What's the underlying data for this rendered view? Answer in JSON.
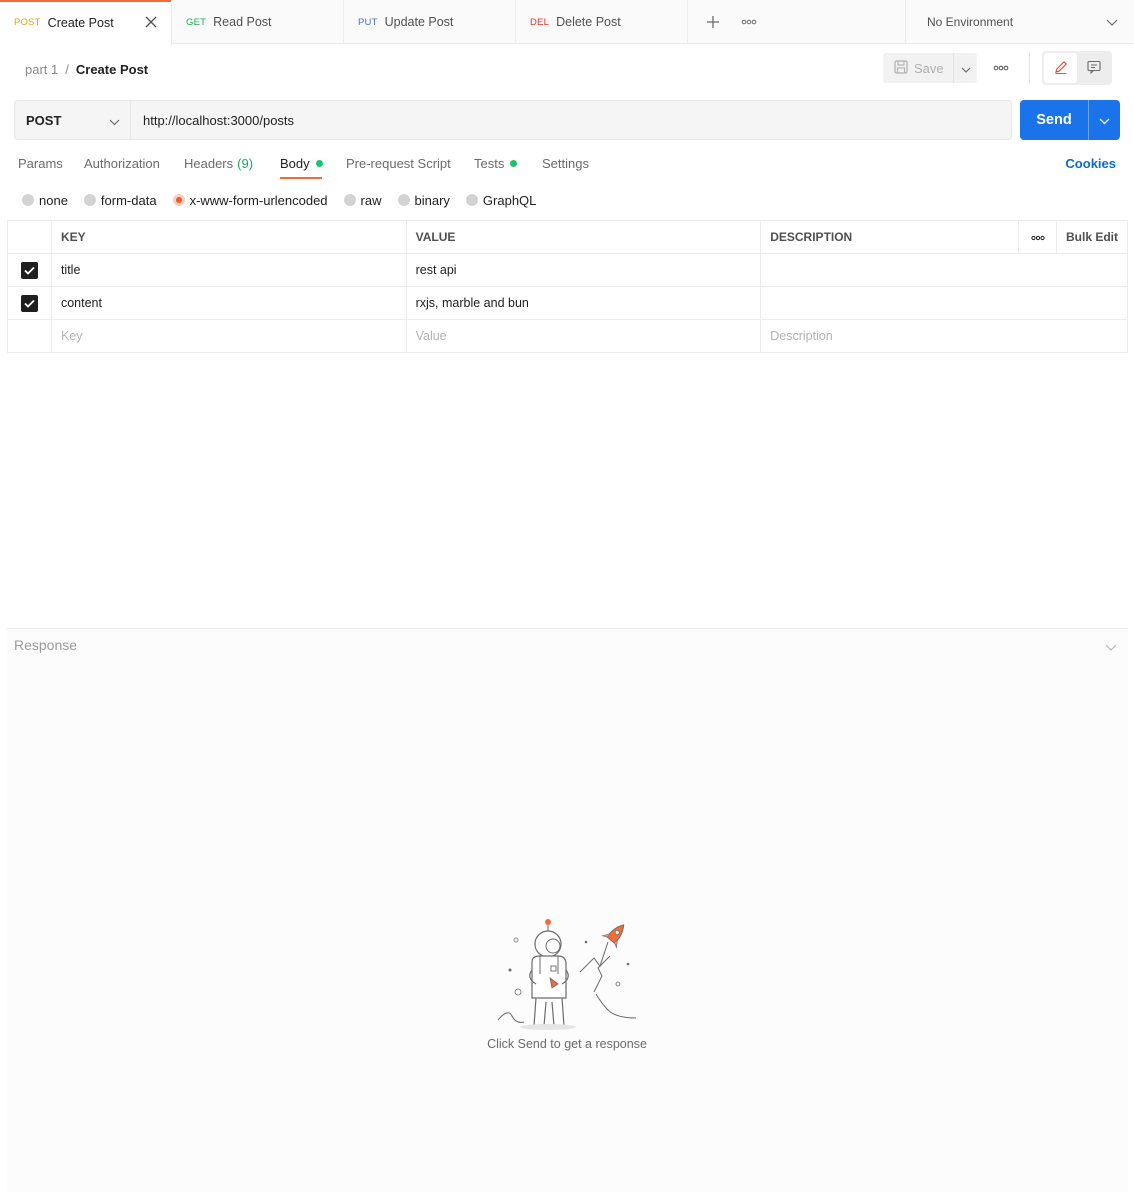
{
  "tabs": [
    {
      "method": "POST",
      "label": "Create Post"
    },
    {
      "method": "GET",
      "label": "Read Post"
    },
    {
      "method": "PUT",
      "label": "Update Post"
    },
    {
      "method": "DEL",
      "label": "Delete Post"
    }
  ],
  "environment": {
    "selected": "No Environment"
  },
  "breadcrumb": {
    "parent": "part 1",
    "separator": "/",
    "current": "Create Post"
  },
  "toolbar": {
    "save_label": "Save"
  },
  "request": {
    "method": "POST",
    "url": "http://localhost:3000/posts",
    "send_label": "Send"
  },
  "request_tabs": {
    "params": "Params",
    "authorization": "Authorization",
    "headers": "Headers",
    "headers_count": "(9)",
    "body": "Body",
    "pre_request": "Pre-request Script",
    "tests": "Tests",
    "settings": "Settings",
    "cookies": "Cookies"
  },
  "body_types": {
    "none": "none",
    "form_data": "form-data",
    "urlencoded": "x-www-form-urlencoded",
    "raw": "raw",
    "binary": "binary",
    "graphql": "GraphQL",
    "selected": "x-www-form-urlencoded"
  },
  "table": {
    "headers": {
      "key": "KEY",
      "value": "VALUE",
      "description": "DESCRIPTION",
      "bulk_edit": "Bulk Edit"
    },
    "rows": [
      {
        "checked": true,
        "key": "title",
        "value": "rest api",
        "description": ""
      },
      {
        "checked": true,
        "key": "content",
        "value": "rxjs, marble and bun",
        "description": ""
      }
    ],
    "placeholders": {
      "key": "Key",
      "value": "Value",
      "description": "Description"
    }
  },
  "response": {
    "title": "Response",
    "empty_message": "Click Send to get a response"
  },
  "colors": {
    "accent": "#f26b3a",
    "send_button": "#1a73e8",
    "status_dot": "#1ec26a",
    "link": "#0d6cc9"
  },
  "icons": {
    "tab_close": "close-icon",
    "new_tab": "plus-icon",
    "more": "more-horizontal-icon",
    "save": "save-icon",
    "edit": "pencil-icon",
    "comments": "comment-icon",
    "dropdown": "chevron-down-icon"
  }
}
